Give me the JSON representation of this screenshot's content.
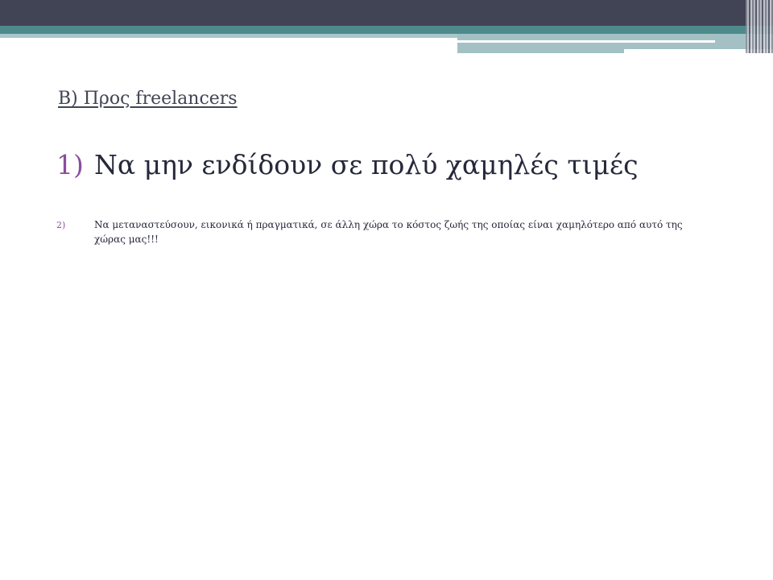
{
  "slide": {
    "subtitle": "Β) Προς freelancers",
    "items": [
      {
        "number": "1)",
        "text": "Να μην ενδίδουν σε πολύ χαμηλές τιμές"
      },
      {
        "number": "2)",
        "text": "Να μεταναστεύσουν, εικονικά ή πραγματικά, σε άλλη χώρα το κόστος ζωής της οποίας είναι χαμηλότερο από αυτό της χώρας μας!!!"
      }
    ]
  },
  "colors": {
    "header_dark": "#414455",
    "header_teal": "#4e8a8c",
    "header_light": "#a3c1c4",
    "number_accent": "#8a4e9c",
    "body_text": "#26283a"
  }
}
